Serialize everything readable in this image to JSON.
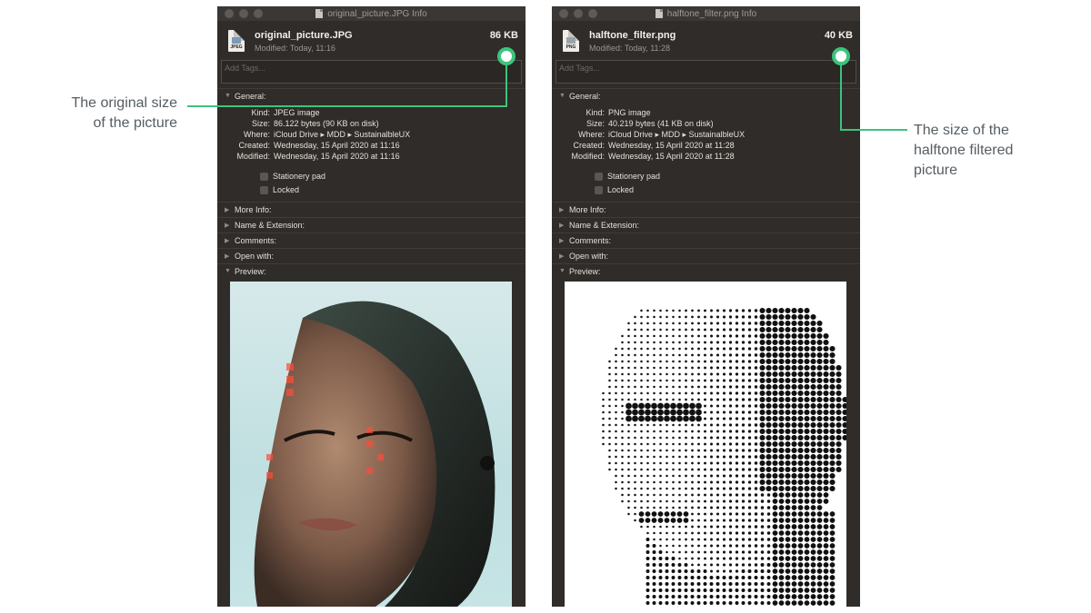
{
  "left_window": {
    "title": "original_picture.JPG Info",
    "file_name": "original_picture.JPG",
    "file_size": "86 KB",
    "modified_summary": "Modified: Today, 11:16",
    "icon_ext": "JPEG",
    "tags_placeholder": "Add Tags...",
    "general_label": "General:",
    "kind_label": "Kind:",
    "kind_value": "JPEG image",
    "size_label": "Size:",
    "size_value": "86.122 bytes (90 KB on disk)",
    "where_label": "Where:",
    "where_value": "iCloud Drive ▸ MDD ▸ SustainalbleUX",
    "created_label": "Created:",
    "created_value": "Wednesday, 15 April 2020 at 11:16",
    "modified_label": "Modified:",
    "modified_value": "Wednesday, 15 April 2020 at 11:16",
    "stationery_label": "Stationery pad",
    "locked_label": "Locked",
    "more_info_label": "More Info:",
    "name_ext_label": "Name & Extension:",
    "comments_label": "Comments:",
    "open_with_label": "Open with:",
    "preview_label": "Preview:"
  },
  "right_window": {
    "title": "halftone_filter.png Info",
    "file_name": "halftone_filter.png",
    "file_size": "40 KB",
    "modified_summary": "Modified: Today, 11:28",
    "icon_ext": "PNG",
    "tags_placeholder": "Add Tags...",
    "general_label": "General:",
    "kind_label": "Kind:",
    "kind_value": "PNG image",
    "size_label": "Size:",
    "size_value": "40.219 bytes (41 KB on disk)",
    "where_label": "Where:",
    "where_value": "iCloud Drive ▸ MDD ▸ SustainalbleUX",
    "created_label": "Created:",
    "created_value": "Wednesday, 15 April 2020 at 11:28",
    "modified_label": "Modified:",
    "modified_value": "Wednesday, 15 April 2020 at 11:28",
    "stationery_label": "Stationery pad",
    "locked_label": "Locked",
    "more_info_label": "More Info:",
    "name_ext_label": "Name & Extension:",
    "comments_label": "Comments:",
    "open_with_label": "Open with:",
    "preview_label": "Preview:"
  },
  "annotations": {
    "left_line1": "The original size",
    "left_line2": "of the picture",
    "right_line1": "The size of the",
    "right_line2": "halftone filtered",
    "right_line3": "picture"
  },
  "colors": {
    "callout": "#3cc47c",
    "window_bg": "#2f2c29",
    "annotation_text": "#555d62"
  },
  "icons": [
    "document-icon",
    "jpeg-file-icon",
    "png-file-icon",
    "disclosure-triangle-icon",
    "callout-marker-icon"
  ]
}
